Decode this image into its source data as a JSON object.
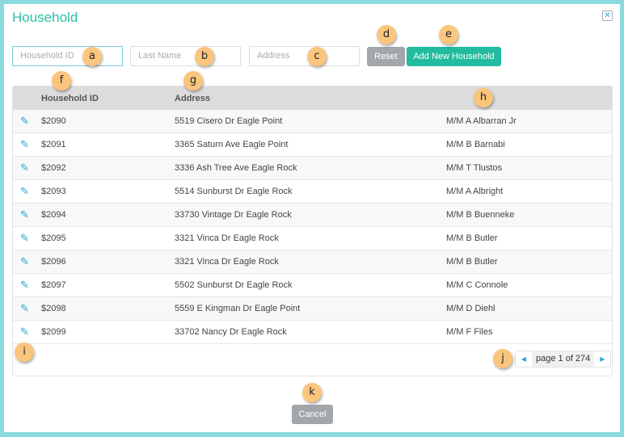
{
  "title": "Household",
  "filters": {
    "household_id_placeholder": "Household ID",
    "last_name_placeholder": "Last Name",
    "address_placeholder": "Address"
  },
  "buttons": {
    "reset": "Reset",
    "add_new": "Add New Household",
    "cancel": "Cancel"
  },
  "colors": {
    "accent": "#2bbfa6",
    "frame": "#8bdade",
    "link": "#2aa7d8",
    "badge": "#fbc57c"
  },
  "table": {
    "headers": [
      "Household ID",
      "Address",
      ""
    ],
    "rows": [
      {
        "id": "$2090",
        "address": "5519 Cisero Dr Eagle Point",
        "name": "M/M A Albarran Jr"
      },
      {
        "id": "$2091",
        "address": "3365 Saturn Ave Eagle Point",
        "name": "M/M B Barnabi"
      },
      {
        "id": "$2092",
        "address": "3336 Ash Tree Ave Eagle Rock",
        "name": "M/M T Tlustos"
      },
      {
        "id": "$2093",
        "address": "5514 Sunburst Dr Eagle Rock",
        "name": "M/M A Albright"
      },
      {
        "id": "$2094",
        "address": "33730 Vintage Dr Eagle Rock",
        "name": "M/M B Buenneke"
      },
      {
        "id": "$2095",
        "address": "3321 Vinca Dr Eagle Rock",
        "name": "M/M B Butler"
      },
      {
        "id": "$2096",
        "address": "3321 Vinca Dr Eagle Rock",
        "name": "M/M B Butler"
      },
      {
        "id": "$2097",
        "address": "5502 Sunburst Dr Eagle Rock",
        "name": "M/M C Connole"
      },
      {
        "id": "$2098",
        "address": "5559 E Kingman Dr Eagle Point",
        "name": "M/M D Diehl"
      },
      {
        "id": "$2099",
        "address": "33702 Nancy Dr Eagle Rock",
        "name": "M/M F Files"
      }
    ]
  },
  "pager": {
    "text": "page 1 of 274",
    "prev_icon": "chevron-left",
    "next_icon": "chevron-right"
  },
  "badges": [
    "a",
    "b",
    "c",
    "d",
    "e",
    "f",
    "g",
    "h",
    "i",
    "j",
    "k"
  ]
}
